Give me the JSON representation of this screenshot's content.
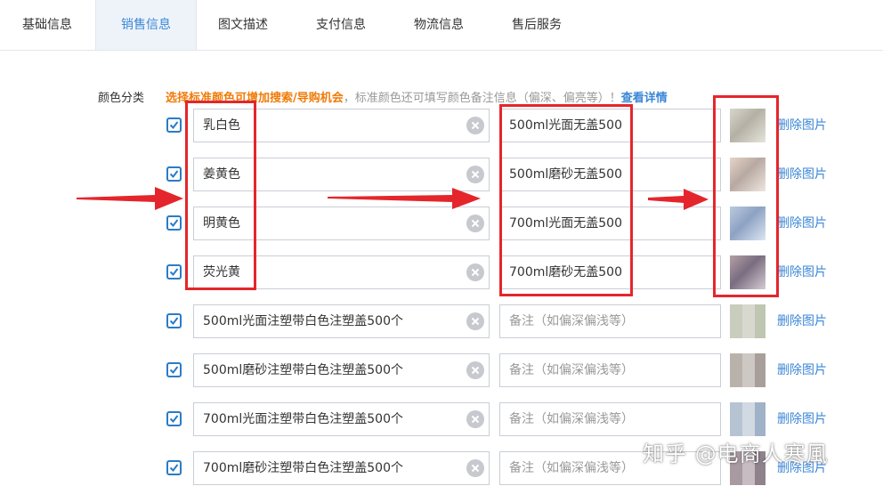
{
  "tabs": [
    {
      "label": "基础信息",
      "active": false
    },
    {
      "label": "销售信息",
      "active": true
    },
    {
      "label": "图文描述",
      "active": false
    },
    {
      "label": "支付信息",
      "active": false
    },
    {
      "label": "物流信息",
      "active": false
    },
    {
      "label": "售后服务",
      "active": false
    }
  ],
  "color_category": {
    "label": "颜色分类",
    "hint_orange": "选择标准颜色可增加搜索/导购机会",
    "hint_gray": "，标准颜色还可填写颜色备注信息（偏深、偏亮等）！",
    "hint_link": "查看详情"
  },
  "rows": [
    {
      "name": "乳白色",
      "note": "500ml光面无盖500",
      "checked": true,
      "delete_label": "删除图片"
    },
    {
      "name": "姜黄色",
      "note": "500ml磨砂无盖500",
      "checked": true,
      "delete_label": "删除图片"
    },
    {
      "name": "明黄色",
      "note": "700ml光面无盖500",
      "checked": true,
      "delete_label": "删除图片"
    },
    {
      "name": "荧光黄",
      "note": "700ml磨砂无盖500",
      "checked": true,
      "delete_label": "删除图片"
    },
    {
      "name": "500ml光面注塑带白色注塑盖500个",
      "note_placeholder": "备注（如偏深偏浅等）",
      "checked": true,
      "delete_label": "删除图片"
    },
    {
      "name": "500ml磨砂注塑带白色注塑盖500个",
      "note_placeholder": "备注（如偏深偏浅等）",
      "checked": true,
      "delete_label": "删除图片"
    },
    {
      "name": "700ml光面注塑带白色注塑盖500个",
      "note_placeholder": "备注（如偏深偏浅等）",
      "checked": true,
      "delete_label": "删除图片"
    },
    {
      "name": "700ml磨砂注塑带白色注塑盖500个",
      "note_placeholder": "备注（如偏深偏浅等）",
      "checked": true,
      "delete_label": "删除图片"
    }
  ],
  "watermark": "知乎 @电商人寒風",
  "colors": {
    "accent": "#3c87d6",
    "orange": "#f07b09",
    "annotation_red": "#e4262c",
    "checkbox_blue": "#2a7cc7"
  },
  "icons": {
    "checkbox": "checkmark-icon",
    "clear": "clear-circle-x-icon"
  }
}
